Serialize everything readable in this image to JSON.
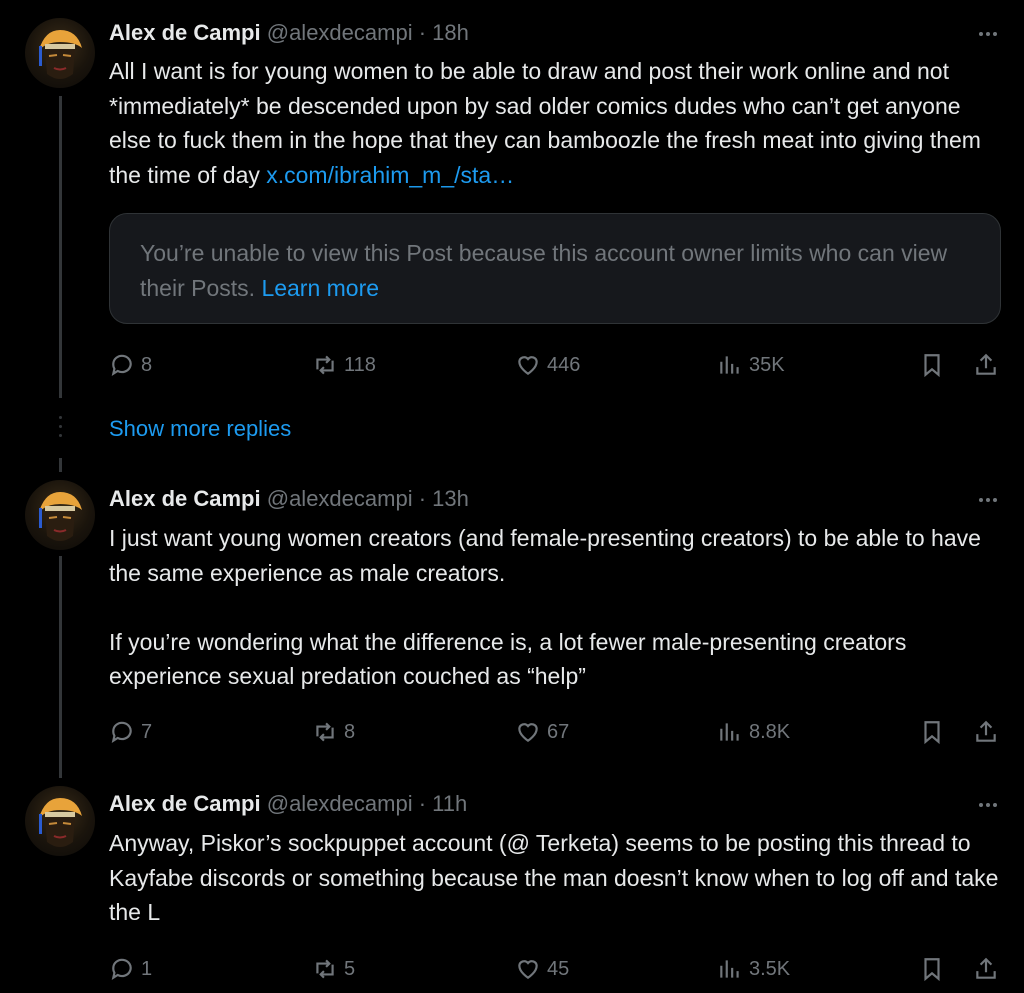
{
  "tweets": [
    {
      "author": "Alex de Campi",
      "handle": "@alexdecampi",
      "separator": "·",
      "time": "18h",
      "text": "All I want is for young women to be able to draw and post their work online and not *immediately* be descended upon by sad older comics dudes who can’t get anyone else to fuck them in the hope that they can bamboozle the fresh meat into giving them the time of day ",
      "link": "x.com/ibrahim_m_/sta…",
      "quote": {
        "text": "You’re unable to view this Post because this account owner limits who can view their Posts. ",
        "link": "Learn more"
      },
      "replies": "8",
      "reposts": "118",
      "likes": "446",
      "views": "35K"
    },
    {
      "author": "Alex de Campi",
      "handle": "@alexdecampi",
      "separator": "·",
      "time": "13h",
      "text": "I just want young women creators (and female-presenting creators) to be able to have the same experience as male creators.\n\nIf you’re wondering what the difference is, a lot fewer male-presenting creators experience sexual predation couched as “help”",
      "replies": "7",
      "reposts": "8",
      "likes": "67",
      "views": "8.8K"
    },
    {
      "author": "Alex de Campi",
      "handle": "@alexdecampi",
      "separator": "·",
      "time": "11h",
      "text": "Anyway, Piskor’s sockpuppet account (@ Terketa) seems to be posting this thread to Kayfabe discords or something because the man doesn’t know when to log off and take the L",
      "replies": "1",
      "reposts": "5",
      "likes": "45",
      "views": "3.5K"
    }
  ],
  "show_more_replies": "Show more replies",
  "colors": {
    "background": "#000000",
    "text": "#e7e9ea",
    "muted": "#71767b",
    "link": "#1d9bf0",
    "card": "#16181c"
  },
  "icons": [
    "reply-icon",
    "repost-icon",
    "like-icon",
    "views-icon",
    "bookmark-icon",
    "share-icon",
    "more-icon"
  ]
}
